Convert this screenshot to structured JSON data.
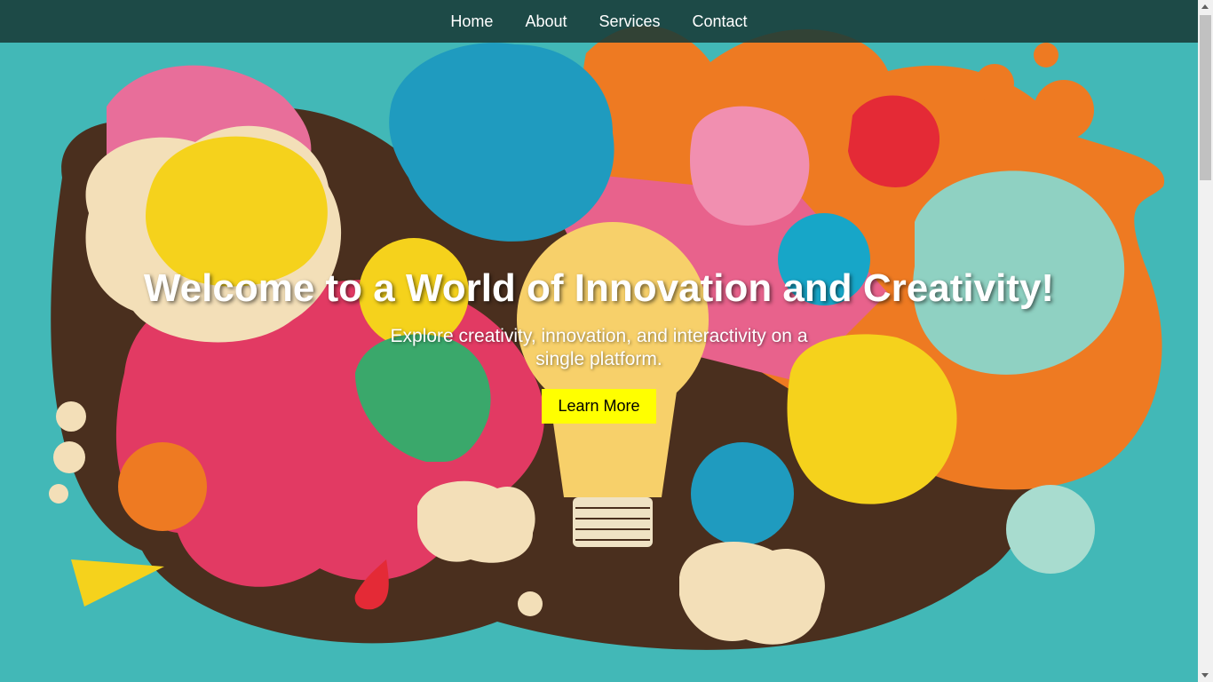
{
  "nav": {
    "items": [
      {
        "label": "Home"
      },
      {
        "label": "About"
      },
      {
        "label": "Services"
      },
      {
        "label": "Contact"
      }
    ]
  },
  "hero": {
    "title": "Welcome to a World of Innovation and Creativity!",
    "subtitle": "Explore creativity, innovation, and interactivity on a single platform.",
    "cta_label": "Learn More",
    "background_image": "paper-art-lightbulb-illustration"
  },
  "colors": {
    "nav_bg": "#183a38",
    "cta_bg": "#ffff00",
    "teal": "#42b8b7",
    "orange": "#ee7a22",
    "pink": "#e8397a",
    "yellow": "#f5d21c",
    "blue": "#1f9bbf",
    "brown": "#4a2f1e"
  }
}
